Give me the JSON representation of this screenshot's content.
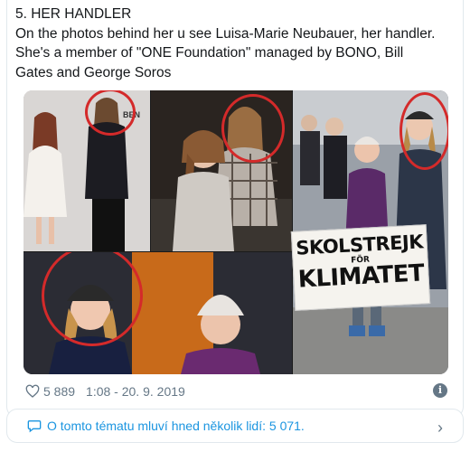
{
  "tweet": {
    "lines": [
      "5. HER HANDLER",
      "On the photos behind her u see Luisa-Marie Neubauer, her handler.",
      "She's a member of \"ONE Foundation\" managed by BONO, Bill",
      "Gates and George Soros"
    ],
    "likes": "5 889",
    "timestamp": "1:08 - 20. 9. 2019"
  },
  "media": {
    "sign_line1": "SKOLSTREJK",
    "sign_line2": "FÖR",
    "sign_line3": "KLIMATET"
  },
  "conversation": {
    "text": "O tomto tématu mluví hned několik lidí: 5 071."
  },
  "icons": {
    "heart": "heart-icon",
    "info": "info-icon",
    "bubble": "speech-bubble-icon",
    "chevron": "chevron-right-icon"
  },
  "colors": {
    "link": "#1b95e0",
    "meta": "#657786",
    "ring": "#d42a2a"
  }
}
